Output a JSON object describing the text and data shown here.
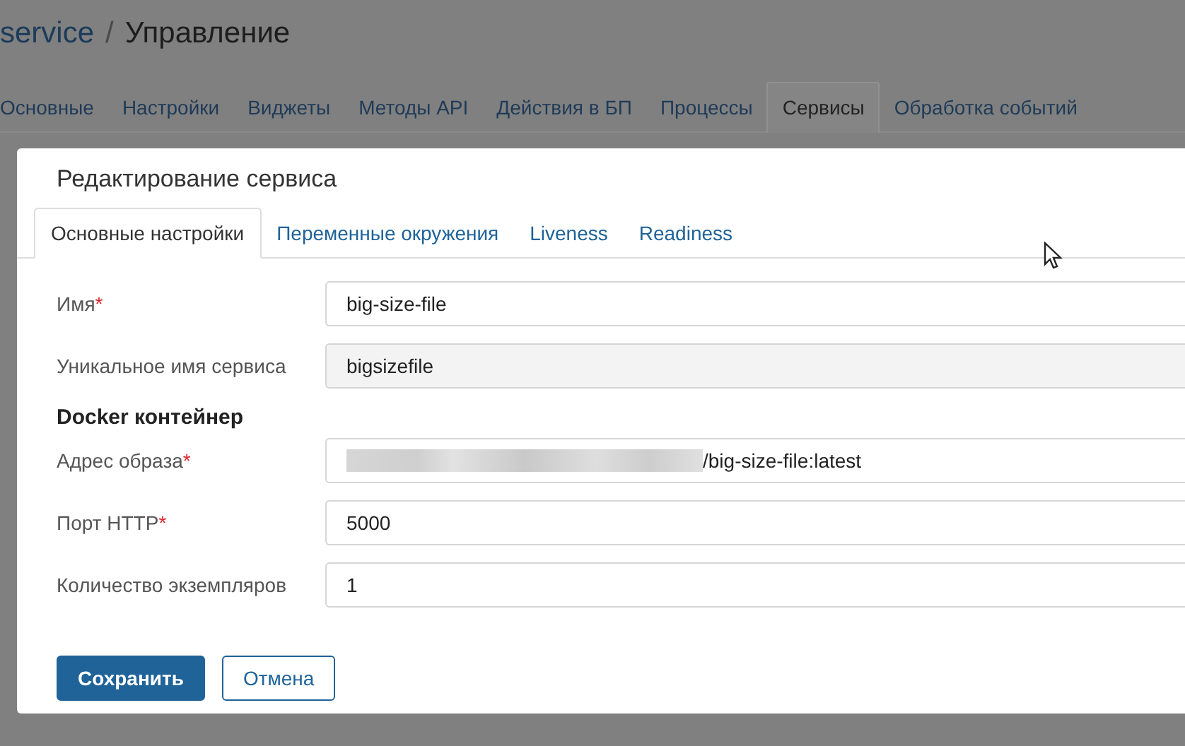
{
  "breadcrumb": {
    "app": "service",
    "separator": "/",
    "page": "Управление"
  },
  "page_tabs": [
    {
      "label": "Основные",
      "selected": false
    },
    {
      "label": "Настройки",
      "selected": false
    },
    {
      "label": "Виджеты",
      "selected": false
    },
    {
      "label": "Методы API",
      "selected": false
    },
    {
      "label": "Действия в БП",
      "selected": false
    },
    {
      "label": "Процессы",
      "selected": false
    },
    {
      "label": "Сервисы",
      "selected": true
    },
    {
      "label": "Обработка событий",
      "selected": false
    }
  ],
  "dialog": {
    "title": "Редактирование сервиса",
    "tabs": [
      {
        "label": "Основные настройки",
        "selected": true
      },
      {
        "label": "Переменные окружения",
        "selected": false
      },
      {
        "label": "Liveness",
        "selected": false
      },
      {
        "label": "Readiness",
        "selected": false
      }
    ],
    "rows": [
      {
        "kind": "field",
        "label": "Имя",
        "required_mark": "*",
        "value": "big-size-file",
        "readonly": false
      },
      {
        "kind": "field",
        "label": "Уникальное имя сервиса",
        "value": "bigsizefile",
        "readonly": true
      },
      {
        "kind": "heading",
        "label": "Docker контейнер"
      },
      {
        "kind": "field",
        "label": "Адрес образа",
        "required_mark": "*",
        "value": "/big-size-file:latest",
        "readonly": false,
        "redacted": true
      },
      {
        "kind": "field",
        "label": "Порт HTTP",
        "required_mark": "*",
        "value": "5000",
        "readonly": false
      },
      {
        "kind": "field",
        "label": "Количество экземпляров",
        "value": "1",
        "readonly": false
      }
    ],
    "buttons": [
      {
        "label": "Сохранить",
        "kind": "primary"
      },
      {
        "label": "Отмена",
        "kind": "secondary"
      }
    ]
  }
}
